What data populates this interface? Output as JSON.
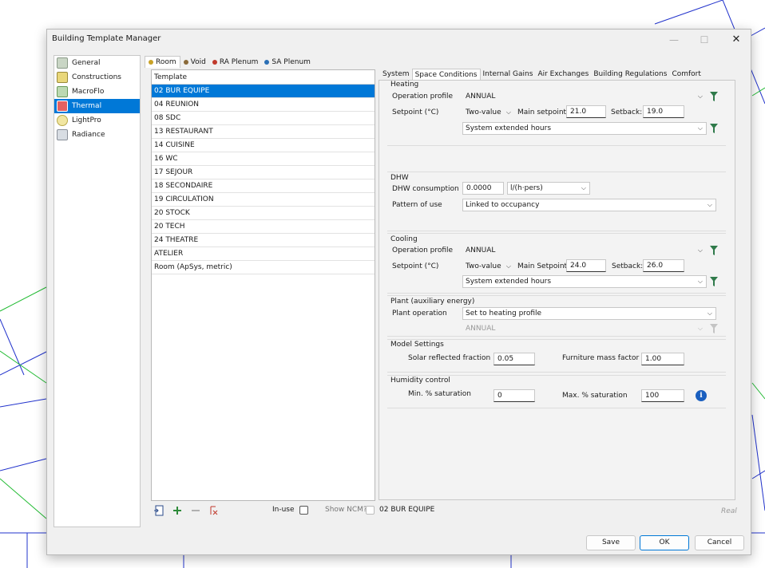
{
  "window": {
    "title": "Building Template Manager"
  },
  "nav": {
    "items": [
      {
        "label": "General",
        "icon": "building-icon"
      },
      {
        "label": "Constructions",
        "icon": "construction-icon"
      },
      {
        "label": "MacroFlo",
        "icon": "macroflo-icon"
      },
      {
        "label": "Thermal",
        "icon": "thermal-icon",
        "active": true
      },
      {
        "label": "LightPro",
        "icon": "lightpro-icon"
      },
      {
        "label": "Radiance",
        "icon": "radiance-icon"
      }
    ]
  },
  "room_tabs": [
    {
      "label": "Room",
      "active": true
    },
    {
      "label": "Void"
    },
    {
      "label": "RA Plenum"
    },
    {
      "label": "SA Plenum"
    }
  ],
  "templates": {
    "header": "Template",
    "rows": [
      "02 BUR EQUIPE",
      "04 REUNION",
      "08 SDC",
      "13 RESTAURANT",
      "14 CUISINE",
      "16 WC",
      "17 SEJOUR",
      "18 SECONDAIRE",
      "19 CIRCULATION",
      "20 STOCK",
      "20 TECH",
      "24 THEATRE",
      "ATELIER",
      "Room (ApSys, metric)"
    ],
    "selected_index": 0
  },
  "bottom": {
    "in_use_label": "In-use",
    "show_ncm_label": "Show NCM?",
    "current_template": "02 BUR EQUIPE",
    "real_label": "Real"
  },
  "content_tabs": [
    {
      "label": "System"
    },
    {
      "label": "Space Conditions",
      "active": true
    },
    {
      "label": "Internal Gains"
    },
    {
      "label": "Air Exchanges"
    },
    {
      "label": "Building Regulations"
    },
    {
      "label": "Comfort"
    }
  ],
  "heating": {
    "title": "Heating",
    "op_profile_label": "Operation profile",
    "op_profile_value": "ANNUAL",
    "setpoint_label": "Setpoint (°C)",
    "setpoint_type": "Two-value",
    "main_label": "Main setpoint:",
    "main_value": "21.0",
    "setback_label": "Setback:",
    "setback_value": "19.0",
    "setback_profile": "System extended hours"
  },
  "dhw": {
    "title": "DHW",
    "consumption_label": "DHW consumption",
    "consumption_value": "0.0000",
    "unit": "l/(h·pers)",
    "pattern_label": "Pattern of use",
    "pattern_value": "Linked to occupancy"
  },
  "cooling": {
    "title": "Cooling",
    "op_profile_label": "Operation profile",
    "op_profile_value": "ANNUAL",
    "setpoint_label": "Setpoint (°C)",
    "setpoint_type": "Two-value",
    "main_label": "Main Setpoint:",
    "main_value": "24.0",
    "setback_label": "Setback:",
    "setback_value": "26.0",
    "setback_profile": "System extended hours"
  },
  "plant": {
    "title": "Plant (auxiliary energy)",
    "op_label": "Plant operation",
    "op_value": "Set to heating profile",
    "profile_value": "ANNUAL"
  },
  "model": {
    "title": "Model Settings",
    "solar_label": "Solar reflected fraction",
    "solar_value": "0.05",
    "furniture_label": "Furniture mass factor",
    "furniture_value": "1.00"
  },
  "humidity": {
    "title": "Humidity control",
    "min_label": "Min. % saturation",
    "min_value": "0",
    "max_label": "Max. % saturation",
    "max_value": "100"
  },
  "buttons": {
    "save": "Save",
    "ok": "OK",
    "cancel": "Cancel"
  },
  "colors": {
    "accent": "#0078d7",
    "filter": "#2f7a4a",
    "info": "#1a5fbf"
  }
}
